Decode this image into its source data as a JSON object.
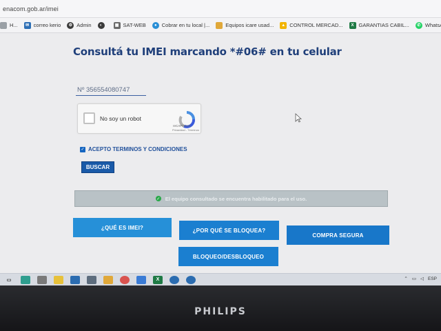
{
  "browser": {
    "url": "enacom.gob.ar/imei",
    "bookmarks": [
      {
        "label": "H...",
        "icon": "folder-icon",
        "color": "#9aa0a6"
      },
      {
        "label": "correo kerio",
        "icon": "mail-icon",
        "color": "#2d6fb5"
      },
      {
        "label": "Admin",
        "icon": "gear-icon",
        "color": "#3b3b3b"
      },
      {
        "label": "",
        "icon": "globe-icon",
        "color": "#3b3b3b"
      },
      {
        "label": "SAT-WEB",
        "icon": "page-icon",
        "color": "#6b6b6b"
      },
      {
        "label": "Cobrar en tu local |...",
        "icon": "handshake-icon",
        "color": "#2a8fd6"
      },
      {
        "label": "Equipos icare usad...",
        "icon": "folder-icon",
        "color": "#e0a83a"
      },
      {
        "label": "CONTROL MERCAD...",
        "icon": "drive-icon",
        "color": "#f2b400"
      },
      {
        "label": "GARANTIAS CABIL...",
        "icon": "excel-icon",
        "color": "#1f7a45"
      },
      {
        "label": "WhatsApp",
        "icon": "whatsapp-icon",
        "color": "#25d366"
      }
    ]
  },
  "page": {
    "title": "Consultá tu IMEI marcando *#06# en tu celular",
    "imei_input": {
      "value": "Nº 356554080747",
      "placeholder": "Nº 356554080747"
    },
    "captcha": {
      "label": "No soy un robot",
      "brand": "reCAPTCHA",
      "privacy": "Privacidad - Términos"
    },
    "terms_label": "ACEPTO TERMINOS Y CONDICIONES",
    "search_button": "BUSCAR",
    "result_message": "El equipo consultado se encuentra habilitado para el uso.",
    "buttons": {
      "what_is_imei": "¿QUÉ ES IMEI?",
      "why_blocked": "¿POR QUÉ SE BLOQUEA?",
      "safe_purchase": "COMPRA SEGURA",
      "block_unblock": "BLOQUEO/DESBLOQUEO"
    }
  },
  "taskbar": {
    "tray_text": "ESP"
  },
  "monitor": {
    "brand": "PHILIPS"
  },
  "colors": {
    "title": "#1f3f7a",
    "primary_button": "#1b7fd0",
    "alert_bg": "#b9c2c6",
    "success": "#2aa84a"
  }
}
